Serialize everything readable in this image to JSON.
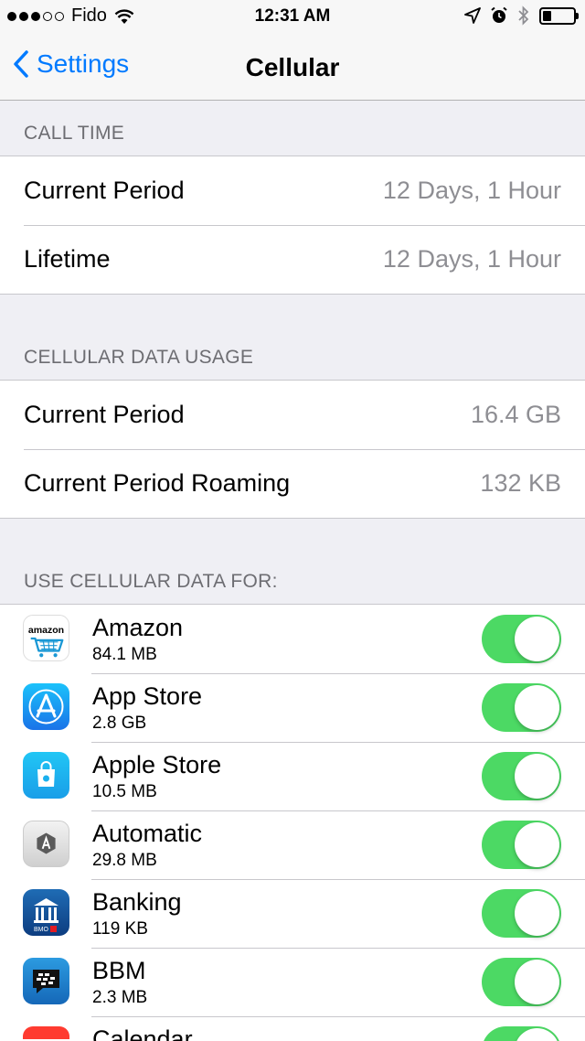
{
  "status_bar": {
    "carrier": "Fido",
    "time": "12:31 AM"
  },
  "nav": {
    "back_label": "Settings",
    "title": "Cellular"
  },
  "call_time": {
    "header": "CALL TIME",
    "rows": [
      {
        "label": "Current Period",
        "value": "12 Days, 1 Hour"
      },
      {
        "label": "Lifetime",
        "value": "12 Days, 1 Hour"
      }
    ]
  },
  "data_usage": {
    "header": "CELLULAR DATA USAGE",
    "rows": [
      {
        "label": "Current Period",
        "value": "16.4 GB"
      },
      {
        "label": "Current Period Roaming",
        "value": "132 KB"
      }
    ]
  },
  "use_cellular": {
    "header": "USE CELLULAR DATA FOR:",
    "apps": [
      {
        "name": "Amazon",
        "usage": "84.1 MB",
        "enabled": true,
        "icon": "amazon-icon",
        "icon_text": "amazon"
      },
      {
        "name": "App Store",
        "usage": "2.8 GB",
        "enabled": true,
        "icon": "app-store-icon"
      },
      {
        "name": "Apple Store",
        "usage": "10.5 MB",
        "enabled": true,
        "icon": "apple-store-icon"
      },
      {
        "name": "Automatic",
        "usage": "29.8 MB",
        "enabled": true,
        "icon": "automatic-icon"
      },
      {
        "name": "Banking",
        "usage": "119 KB",
        "enabled": true,
        "icon": "banking-icon",
        "icon_text": "BMO"
      },
      {
        "name": "BBM",
        "usage": "2.3 MB",
        "enabled": true,
        "icon": "bbm-icon"
      },
      {
        "name": "Calendar",
        "usage": "",
        "enabled": true,
        "icon": "calendar-icon"
      }
    ]
  },
  "colors": {
    "accent": "#007aff",
    "toggle_on": "#4cd964",
    "background": "#efeff4"
  }
}
